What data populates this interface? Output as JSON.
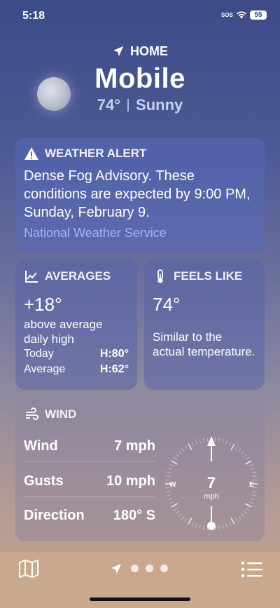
{
  "status": {
    "time": "5:18",
    "sos": "SOS",
    "battery": "55"
  },
  "header": {
    "home_label": "HOME",
    "city": "Mobile",
    "temperature": "74°",
    "condition": "Sunny"
  },
  "alert": {
    "title": "WEATHER ALERT",
    "text": "Dense Fog Advisory. These conditions are expected by 9:00 PM, Sunday, February 9.",
    "source": "National Weather Service"
  },
  "averages": {
    "title": "AVERAGES",
    "value": "+18°",
    "description": "above average daily high",
    "today_label": "Today",
    "today_value": "H:80°",
    "average_label": "Average",
    "average_value": "H:62°"
  },
  "feels_like": {
    "title": "FEELS LIKE",
    "value": "74°",
    "description": "Similar to the actual temperature."
  },
  "wind": {
    "title": "WIND",
    "rows": [
      {
        "label": "Wind",
        "value": "7 mph"
      },
      {
        "label": "Gusts",
        "value": "10 mph"
      },
      {
        "label": "Direction",
        "value": "180° S"
      }
    ],
    "compass_speed": "7",
    "compass_unit": "mph",
    "compass_west": "W",
    "compass_east": "E"
  },
  "tabbar": {
    "icons": [
      "map-icon",
      "location-arrow-icon",
      "page-dot",
      "page-dot",
      "page-dot",
      "list-icon"
    ]
  },
  "colors": {
    "alert_source": "#a9b4ea",
    "condition_text": "#c7d0f2"
  }
}
